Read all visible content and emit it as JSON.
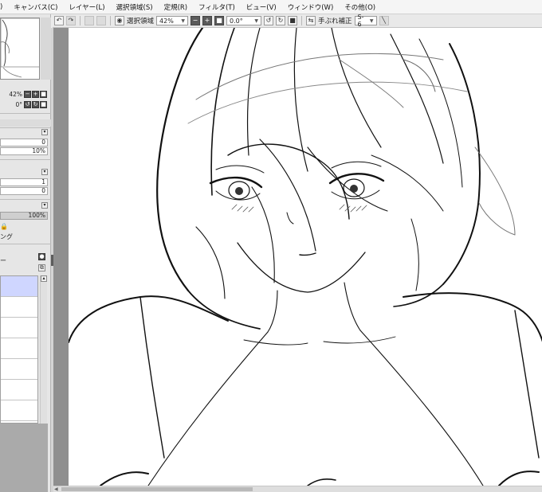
{
  "menu": {
    "items": [
      {
        "label": ")"
      },
      {
        "label": "キャンバス(C)"
      },
      {
        "label": "レイヤー(L)"
      },
      {
        "label": "選択領域(S)"
      },
      {
        "label": "定規(R)"
      },
      {
        "label": "フィルタ(T)"
      },
      {
        "label": "ビュー(V)"
      },
      {
        "label": "ウィンドウ(W)"
      },
      {
        "label": "その他(O)"
      }
    ]
  },
  "toolbar": {
    "selection_label": "選択領域",
    "zoom_value": "42%",
    "rotation_value": "0.0°",
    "stabilizer_label": "手ぶれ補正",
    "stabilizer_value": "S-6",
    "icons": [
      "undo-icon",
      "redo-icon",
      "eye-icon",
      "zoom-out-icon",
      "zoom-in-icon",
      "reset-zoom-icon",
      "rotate-left-icon",
      "rotate-right-icon",
      "reset-rotation-icon",
      "flip-icon",
      "pen-icon"
    ]
  },
  "navigator": {
    "zoom": "42%",
    "rotation": "0°"
  },
  "brush_panel": {
    "field1": "0",
    "field2": "10%",
    "field3": "1",
    "field4": "0",
    "opacity": "100%",
    "lock_label": "ング"
  },
  "layers": {
    "header_text": "ー",
    "selected_index": 0,
    "row_count": 7
  },
  "colors": {
    "selected_layer": "#cfd6ff",
    "canvas_bg": "#ffffff",
    "workspace_bg": "#8f8f8f"
  }
}
